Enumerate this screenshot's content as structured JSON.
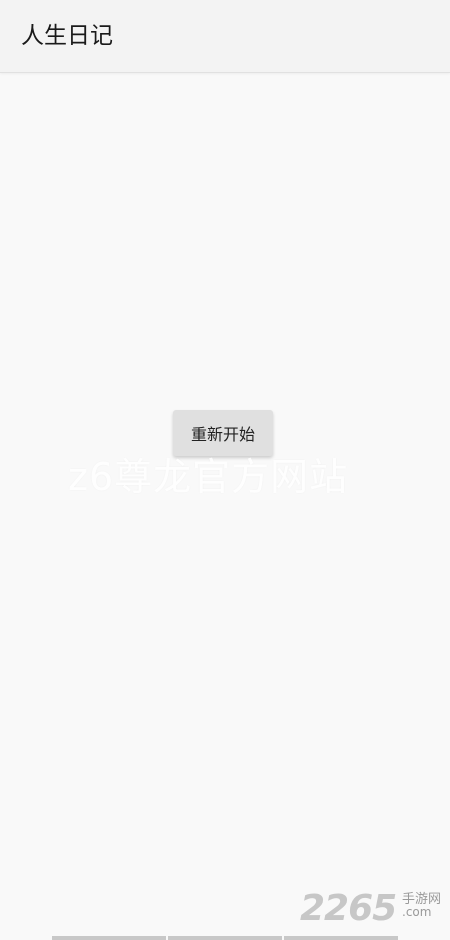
{
  "app_bar": {
    "title": "人生日记"
  },
  "main": {
    "restart_label": "重新开始"
  },
  "watermarks": {
    "center_text": "z6尊龙官方网站",
    "logo_number": "2265",
    "logo_text": "手游网",
    "logo_domain": ".com"
  },
  "colors": {
    "background": "#f9f9f9",
    "app_bar": "#f3f3f3",
    "button": "#e0e0e0",
    "text": "#1a1a1a"
  }
}
